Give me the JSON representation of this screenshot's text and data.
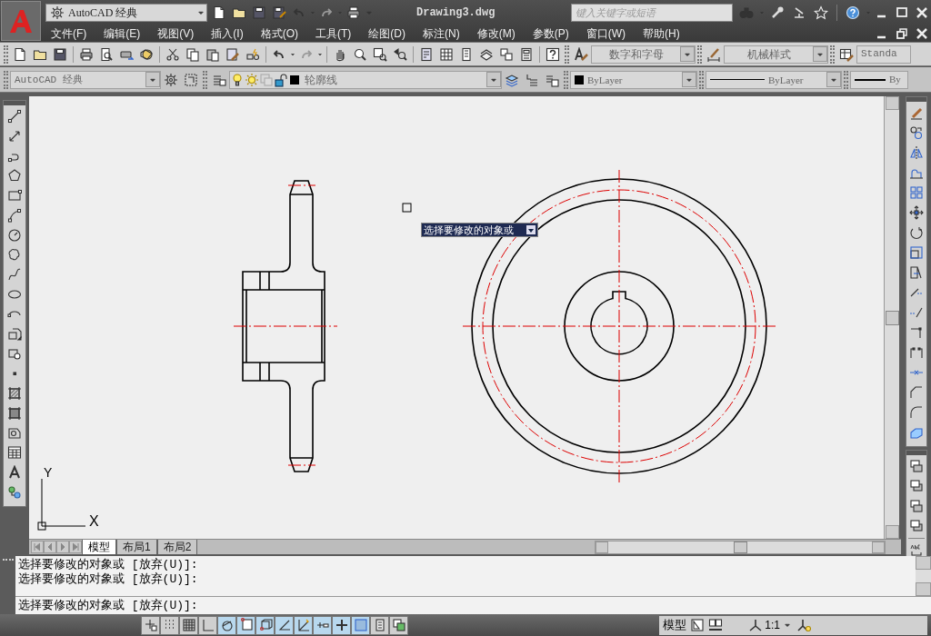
{
  "title_bar": {
    "workspace": "AutoCAD 经典",
    "title": "Drawing3.dwg",
    "search": {
      "placeholder": "键入关键字或短语"
    }
  },
  "menu": [
    "文件(F)",
    "编辑(E)",
    "视图(V)",
    "插入(I)",
    "格式(O)",
    "工具(T)",
    "绘图(D)",
    "标注(N)",
    "修改(M)",
    "参数(P)",
    "窗口(W)",
    "帮助(H)"
  ],
  "styles_toolbar": {
    "text_style": "数字和字母",
    "dim_style": "机械样式",
    "table_style": "Standa"
  },
  "workspace_toolbar": {
    "workspace": "AutoCAD 经典"
  },
  "layers_toolbar": {
    "layer": "轮廓线"
  },
  "properties_toolbar": {
    "color_setting": "ByLayer",
    "linetype_setting": "ByLayer",
    "lineweight_setting": "By"
  },
  "canvas": {
    "tooltip": "选择要修改的对象或",
    "ucs": {
      "y_label": "Y",
      "x_label": "X"
    }
  },
  "layout_tabs": [
    {
      "label": "模型",
      "selected": true
    },
    {
      "label": "布局1",
      "selected": false
    },
    {
      "label": "布局2",
      "selected": false
    }
  ],
  "command_history": [
    "选择要修改的对象或 [放弃(U)]:",
    "选择要修改的对象或 [放弃(U)]:"
  ],
  "command_line": "选择要修改的对象或 [放弃(U)]:",
  "status_bar": {
    "toggles": [
      {
        "on": false
      },
      {
        "on": false
      },
      {
        "on": false
      },
      {
        "on": false
      },
      {
        "on": true
      },
      {
        "on": true
      },
      {
        "on": true
      },
      {
        "on": true
      },
      {
        "on": true
      },
      {
        "on": true
      },
      {
        "on": true
      },
      {
        "on": true
      },
      {
        "on": false
      },
      {
        "on": false
      }
    ],
    "space": "模型",
    "scale": "1:1"
  }
}
